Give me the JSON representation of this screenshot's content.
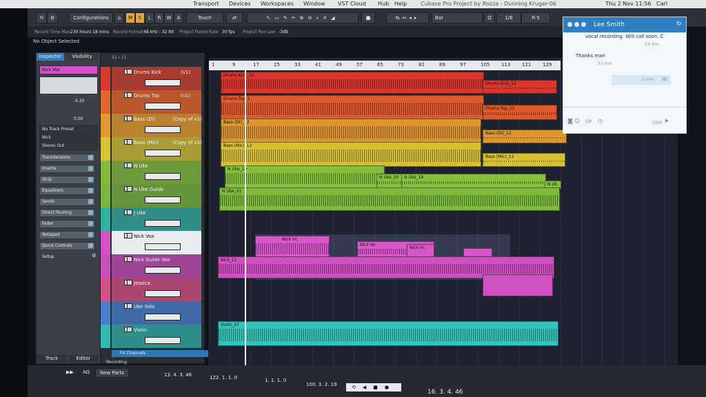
{
  "menubar": {
    "items": [
      "Transport",
      "Devices",
      "Workspaces",
      "Window",
      "VST Cloud",
      "Hub",
      "Help"
    ],
    "window_title": "Cubase Pro Project by Rozza - Dunning Kruger-06",
    "clock": "Thu 2 Nov 11:56",
    "user": "Carl"
  },
  "toolbar": {
    "configurations": "Configurations",
    "touch": "Touch",
    "m": "M",
    "s": "S",
    "l": "L",
    "r": "R",
    "w": "W",
    "a": "A",
    "grid_type": "Bar",
    "quantize": "1/8",
    "quantize_suffix": "R-5"
  },
  "info_line": {
    "record_time_max_label": "Record Time Max",
    "record_time_max": "230 hours 18 mins",
    "record_format_label": "Record Format",
    "record_format": "48 kHz - 32 Bit",
    "frame_rate_label": "Project Frame Rate",
    "frame_rate": "30 fps",
    "pan_law_label": "Project Pan Law",
    "pan_law": "-3dB"
  },
  "status": {
    "selection": "No Object Selected"
  },
  "inspector": {
    "tab_inspector": "Inspector",
    "tab_visibility": "Visibility",
    "track_name": "Nick Vox",
    "volume": "-5.20",
    "pan": "0.00",
    "preset": "No Track Preset",
    "input": "Nick",
    "output": "Stereo Out",
    "sections": [
      "TrackVersions",
      "Inserts",
      "Strip",
      "Equalizers",
      "Sends",
      "Direct Routing",
      "Fader",
      "Notepad",
      "Quick Controls"
    ],
    "setup": "Setup",
    "bottom_tab_track": "Track",
    "bottom_tab_editor": "Editor"
  },
  "tracklist": {
    "counter": "11 / 11",
    "tracks": [
      {
        "name": "Drums Kick",
        "version": "(v1)",
        "color": "#d93a2b"
      },
      {
        "name": "Drums Top",
        "version": "(v1)",
        "color": "#e0672a"
      },
      {
        "name": "Bass (DI)",
        "version": "(Copy of v1)",
        "color": "#e39a2e"
      },
      {
        "name": "Bass (Mic)",
        "version": "(Copy of v1)",
        "color": "#d9c331"
      },
      {
        "name": "N Uke",
        "version": "",
        "color": "#83bc3a"
      },
      {
        "name": "N Uke Guide",
        "version": "",
        "color": "#79b83c"
      },
      {
        "name": "J Uke",
        "version": "",
        "color": "#2db3a0"
      },
      {
        "name": "Nick Vox",
        "version": "",
        "color": "#d54fc6"
      },
      {
        "name": "Nick Guide Vox",
        "version": "",
        "color": "#c94fbc"
      },
      {
        "name": "Jessica",
        "version": "",
        "color": "#d94f88"
      },
      {
        "name": "Uke Solo",
        "version": "",
        "color": "#4a7fd0"
      },
      {
        "name": "Violin",
        "version": "",
        "color": "#2fb9b2"
      }
    ],
    "fx_channels": "FX Channels",
    "recording": "Recording"
  },
  "ruler": {
    "marks": [
      "1",
      "9",
      "17",
      "25",
      "33",
      "41",
      "49",
      "57",
      "65",
      "73",
      "81",
      "89",
      "97",
      "105",
      "113",
      "121",
      "129"
    ]
  },
  "clips": {
    "drums_kick_a": "Drums Kick_12",
    "drums_kick_b": "Drums Kick_12",
    "drums_top_a": "Drums Top_1",
    "drums_top_b": "Drums Top_12",
    "bass_di_a": "Bass (DI)_12",
    "bass_di_b": "Bass (DI)_12",
    "bass_mic_a": "Bass (Mic)_12",
    "bass_mic_b": "Bass (Mic)_12",
    "nuke_a": "N Uke_19",
    "nuke_b": "N Uke_20",
    "nuke_c": "N Uke_19",
    "nuke_d": "N Uk",
    "nuke_guide": "N Uke_11",
    "nick_vox_a": "Nick Vc",
    "nick_vox_b": "Nick Vo",
    "nick_vox_c": "Nick Vc",
    "nick_guide": "Nick_11",
    "violin": "Violin_07"
  },
  "chat": {
    "contact": "Lee Smith",
    "msg1": "vocal recording. Will call soon. C",
    "msg1_time": "54 min",
    "msg2": "Thanks man",
    "msg2_time": "53 min",
    "call_time": "2 min",
    "gif": "GIF",
    "counter": "1000"
  },
  "transport": {
    "aq": "AQ",
    "new_parts": "New Parts",
    "left_locator": "13. 4. 3. 46",
    "right_locator": "122. 1. 1. 0",
    "pos_a": "1. 1. 1. 0",
    "pos_b": "100. 3. 2. 19",
    "primary_time": "16. 3. 4. 46"
  }
}
